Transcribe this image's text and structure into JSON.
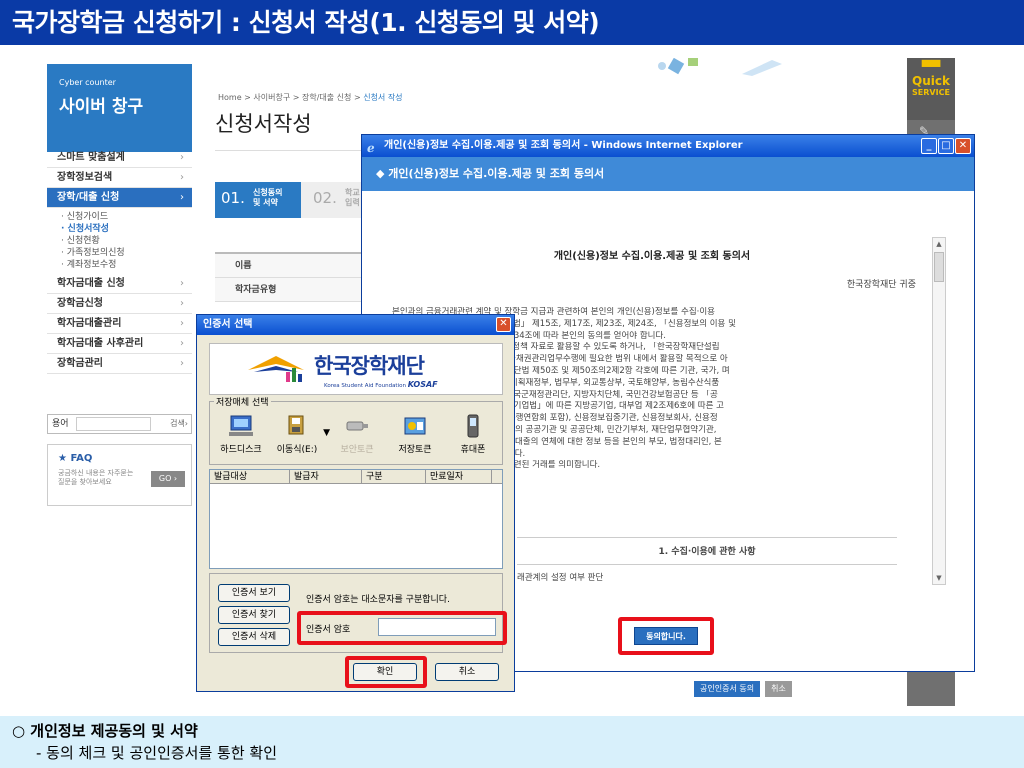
{
  "slide": {
    "title": "국가장학금 신청하기 : 신청서 작성(1. 신청동의 및 서약)",
    "note_heading": "○ 개인정보 제공동의 및 서약",
    "note_detail": "- 동의 체크 및 공인인증서를 통한 확인"
  },
  "sidebar": {
    "header_en": "Cyber counter",
    "header_ko": "사이버 창구",
    "items": [
      {
        "label": "스마트 맞춤설계"
      },
      {
        "label": "장학정보검색"
      },
      {
        "label": "장학/대출 신청"
      }
    ],
    "subitems": [
      {
        "label": "· 신청가이드"
      },
      {
        "label": "· 신청서작성"
      },
      {
        "label": "· 신청현황"
      },
      {
        "label": "· 가족정보의신청"
      },
      {
        "label": "· 계좌정보수정"
      }
    ],
    "items2": [
      {
        "label": "학자금대출 신청"
      },
      {
        "label": "장학금신청"
      },
      {
        "label": "학자금대출관리"
      },
      {
        "label": "학자금대출 사후관리"
      },
      {
        "label": "장학금관리"
      }
    ],
    "arrow": "›",
    "search_label": "용어",
    "search_button": "검색›",
    "faq_title": "FAQ",
    "faq_desc": "궁금하신 내용은 자주묻는 질문을 찾아보세요",
    "faq_go": "GO ›"
  },
  "site": {
    "breadcrumb": "Home > 사이버창구 > 장학/대출 신청 > ",
    "breadcrumb_current": "신청서 작성",
    "page_title": "신청서작성",
    "step1_num": "01.",
    "step1_label_1": "신청동의",
    "step1_label_2": "및 서약",
    "step2_num": "02.",
    "step2_label_1": "학교",
    "step2_label_2": "입력",
    "form_rows": [
      {
        "label": "이름"
      },
      {
        "label": "학자금유형"
      }
    ],
    "bottom_btn1": "공인인증서 동의",
    "bottom_btn2": "취소",
    "quick_a": "Quick",
    "quick_b": "SERVICE"
  },
  "ie": {
    "title": "개인(신용)정보 수집.이용.제공 및 조회 동의서 - Windows Internet Explorer",
    "header": "◆ 개인(신용)정보 수집.이용.제공 및 조회 동의서",
    "doc_title": "개인(신용)정보 수집.이용.제공 및 조회 동의서",
    "doc_org": "한국장학재단 귀중",
    "doc_lines": [
      "본인과의 금융거래관련 계약 및 장학금 지급과 관련하여 본인의 개인(신용)정보를 수집·이용",
      "자 하는 경우에는 「개인정보 보호법」 제15조, 제17조, 제23조, 제24조, 「신용정보의 이용 및",
      "용정보법」 제32조, 제33조 및 제34조에 따라 본인의 동의를 얻어야 합니다.",
      "신용을 판단하거나, 공공기관에서 정책 자료로 활용할 수 있도록 하거나, 「한국장학재단설립",
      "법」 제16조의 사업 및 학자금대출채권관리업무수행에 필요한 범위 내에서 활용할 목적으로 아",
      "(신용)정보를 수집·이용·조회 및 재단법 제50조 및 제50조의2제2항 각호에 따른 기관, 국가, 며",
      "행정안전부, 국방부, 보건복지부, 기획재정부, 법무부, 외교통상부, 국토해양부, 농림수산식품",
      "경찰청, 소방방재청 등 산하기관), 국군재정관리단, 지방자치단체, 국민건강보험공단 등 「공",
      "법률」에 따른 공공기관, 「지방공기업법」에 따른 지방공기업, 대부업 제2조제6호에 따른 고",
      "하는 비영리 장학법인, 금융회사(은행연합회 포함), 신용정보집중기관, 신용정보회사, 신용정",
      "평가원, 한국교육학술정보원, 그 밖의 공공기관 및 공공단체, 민간기부처, 재단업무협약기관,",
      "제공하여 재단이 학자금대출 및 동 대출의 연체에 대한 정보 등을 본인의 부모, 법정대리인, 본",
      "등교육기관에 통지하는데 동의합니다.",
      ", 부수업무(사후관리 업무 등)와 관련된 거래를 의미합니다."
    ],
    "section_title": "1. 수집·이용에 관한 사항",
    "section_line": "래관계의 설정 여부 판단",
    "agree_btn": "동의합니다.",
    "icon_up": "▲",
    "icon_down": "▼",
    "ctrl_min": "_",
    "ctrl_max": "□",
    "ctrl_close": "✕"
  },
  "cert": {
    "title": "인증서 선택",
    "close": "✕",
    "org_ko": "한국장학재단",
    "org_en": "Korea Student Aid Foundation",
    "org_abbr": "KOSAF",
    "storage_legend": "저장매체 선택",
    "devices": [
      {
        "label": "하드디스크"
      },
      {
        "label": "이동식(E:)"
      },
      {
        "label": "보안토큰"
      },
      {
        "label": "저장토큰"
      },
      {
        "label": "휴대폰"
      }
    ],
    "dropdown_arrow": "▼",
    "columns": [
      {
        "label": "발급대상"
      },
      {
        "label": "발급자"
      },
      {
        "label": "구분"
      },
      {
        "label": "만료일자"
      }
    ],
    "btn_view": "인증서 보기",
    "btn_find": "인증서 찾기",
    "btn_delete": "인증서 삭제",
    "case_note": "인증서 암호는 대소문자를 구분합니다.",
    "pw_label": "인증서 암호",
    "pw_value": "",
    "btn_ok": "확인",
    "btn_cancel": "취소"
  },
  "colors": {
    "title_bar": "#0a3aa6",
    "note_bg": "#d8f0fb",
    "highlight": "#e8101a",
    "site_blue": "#2a7ac3"
  }
}
